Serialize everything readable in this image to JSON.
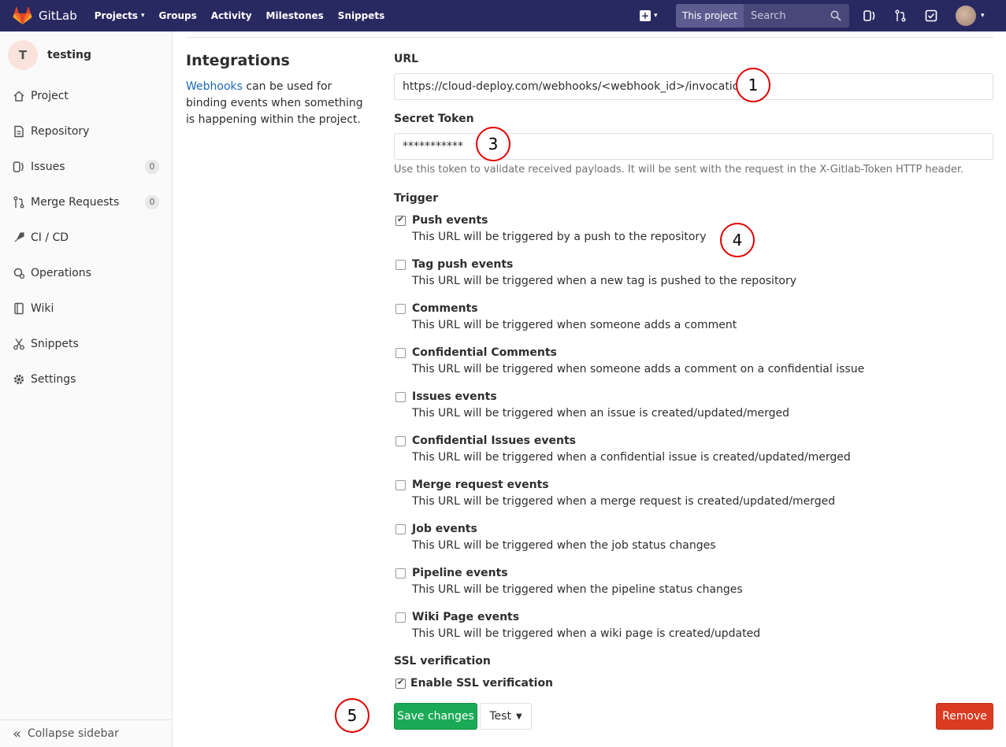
{
  "nav": {
    "brand": "GitLab",
    "links": [
      "Projects",
      "Groups",
      "Activity",
      "Milestones",
      "Snippets"
    ],
    "search_scope": "This project",
    "search_placeholder": "Search",
    "colors": {
      "bar": "#292961",
      "logo": "#e2432a"
    }
  },
  "sidebar": {
    "project_initial": "T",
    "project_name": "testing",
    "items": [
      {
        "label": "Project",
        "icon": "home-icon"
      },
      {
        "label": "Repository",
        "icon": "doc-icon"
      },
      {
        "label": "Issues",
        "icon": "issues-icon",
        "badge": "0"
      },
      {
        "label": "Merge Requests",
        "icon": "merge-icon",
        "badge": "0"
      },
      {
        "label": "CI / CD",
        "icon": "rocket-icon"
      },
      {
        "label": "Operations",
        "icon": "operations-icon"
      },
      {
        "label": "Wiki",
        "icon": "book-icon"
      },
      {
        "label": "Snippets",
        "icon": "scissors-icon"
      },
      {
        "label": "Settings",
        "icon": "gear-icon"
      }
    ],
    "collapse_label": "Collapse sidebar"
  },
  "section": {
    "title": "Integrations",
    "desc_link": "Webhooks",
    "desc_rest": " can be used for binding events when something is happening within the project."
  },
  "form": {
    "url_label": "URL",
    "url_value": "https://cloud-deploy.com/webhooks/<webhook_id>/invocations",
    "token_label": "Secret Token",
    "token_value": "***********",
    "token_help": "Use this token to validate received payloads. It will be sent with the request in the X-Gitlab-Token HTTP header.",
    "trigger_label": "Trigger",
    "triggers": [
      {
        "title": "Push events",
        "desc": "This URL will be triggered by a push to the repository",
        "checked": true
      },
      {
        "title": "Tag push events",
        "desc": "This URL will be triggered when a new tag is pushed to the repository",
        "checked": false
      },
      {
        "title": "Comments",
        "desc": "This URL will be triggered when someone adds a comment",
        "checked": false
      },
      {
        "title": "Confidential Comments",
        "desc": "This URL will be triggered when someone adds a comment on a confidential issue",
        "checked": false
      },
      {
        "title": "Issues events",
        "desc": "This URL will be triggered when an issue is created/updated/merged",
        "checked": false
      },
      {
        "title": "Confidential Issues events",
        "desc": "This URL will be triggered when a confidential issue is created/updated/merged",
        "checked": false
      },
      {
        "title": "Merge request events",
        "desc": "This URL will be triggered when a merge request is created/updated/merged",
        "checked": false
      },
      {
        "title": "Job events",
        "desc": "This URL will be triggered when the job status changes",
        "checked": false
      },
      {
        "title": "Pipeline events",
        "desc": "This URL will be triggered when the pipeline status changes",
        "checked": false
      },
      {
        "title": "Wiki Page events",
        "desc": "This URL will be triggered when a wiki page is created/updated",
        "checked": false
      }
    ],
    "ssl_label": "SSL verification",
    "ssl_option": "Enable SSL verification",
    "ssl_checked": true,
    "save_label": "Save changes",
    "test_label": "Test",
    "remove_label": "Remove"
  },
  "markers": [
    "1",
    "3",
    "4",
    "5"
  ]
}
